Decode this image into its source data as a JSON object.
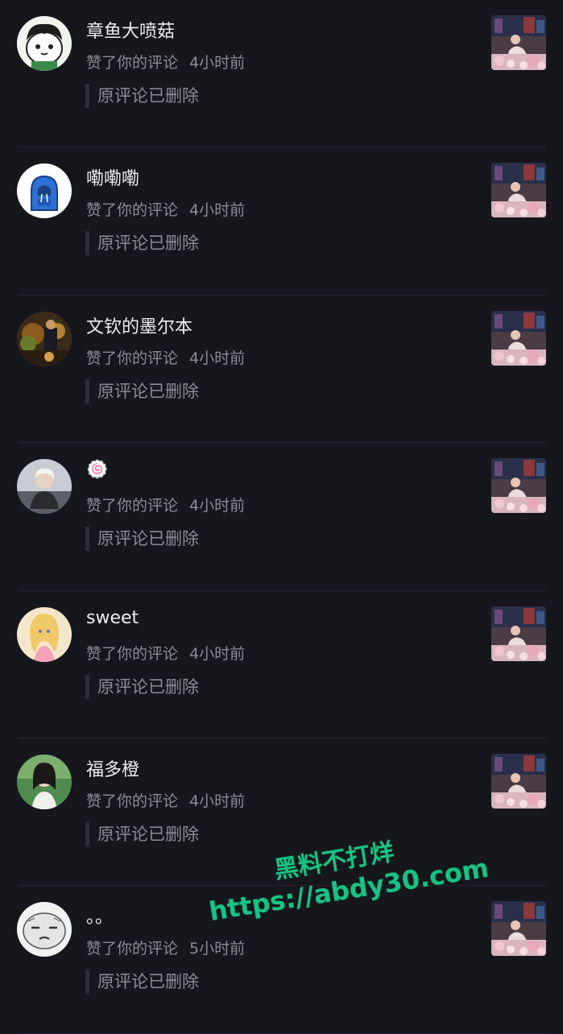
{
  "notifications": [
    {
      "name": "章鱼大喷菇",
      "action": "赞了你的评论",
      "time": "4小时前",
      "quote": "原评论已删除",
      "avatar": "cartoon-panda-avatar"
    },
    {
      "name": "嘞嘞嘞",
      "action": "赞了你的评论",
      "time": "4小时前",
      "quote": "原评论已删除",
      "avatar": "blue-hoodie-avatar"
    },
    {
      "name": "文钦的墨尔本",
      "action": "赞了你的评论",
      "time": "4小时前",
      "quote": "原评论已删除",
      "avatar": "photo-avatar-dark"
    },
    {
      "name": "🍥",
      "action": "赞了你的评论",
      "time": "4小时前",
      "quote": "原评论已删除",
      "avatar": "photo-avatar-girl"
    },
    {
      "name": "sweet",
      "action": "赞了你的评论",
      "time": "4小时前",
      "quote": "原评论已删除",
      "avatar": "anime-avatar"
    },
    {
      "name": "福多橙",
      "action": "赞了你的评论",
      "time": "4小时前",
      "quote": "原评论已删除",
      "avatar": "photo-avatar-green"
    },
    {
      "name": "。。",
      "action": "赞了你的评论",
      "time": "5小时前",
      "quote": "原评论已删除",
      "avatar": "sketch-face-avatar"
    }
  ],
  "watermark": {
    "line1": "黑料不打烊",
    "line2": "https://abdy30.com"
  },
  "colors": {
    "background": "#16161d",
    "name_text": "#ededf0",
    "secondary_text": "#8b8b93",
    "watermark": "#17c383"
  }
}
